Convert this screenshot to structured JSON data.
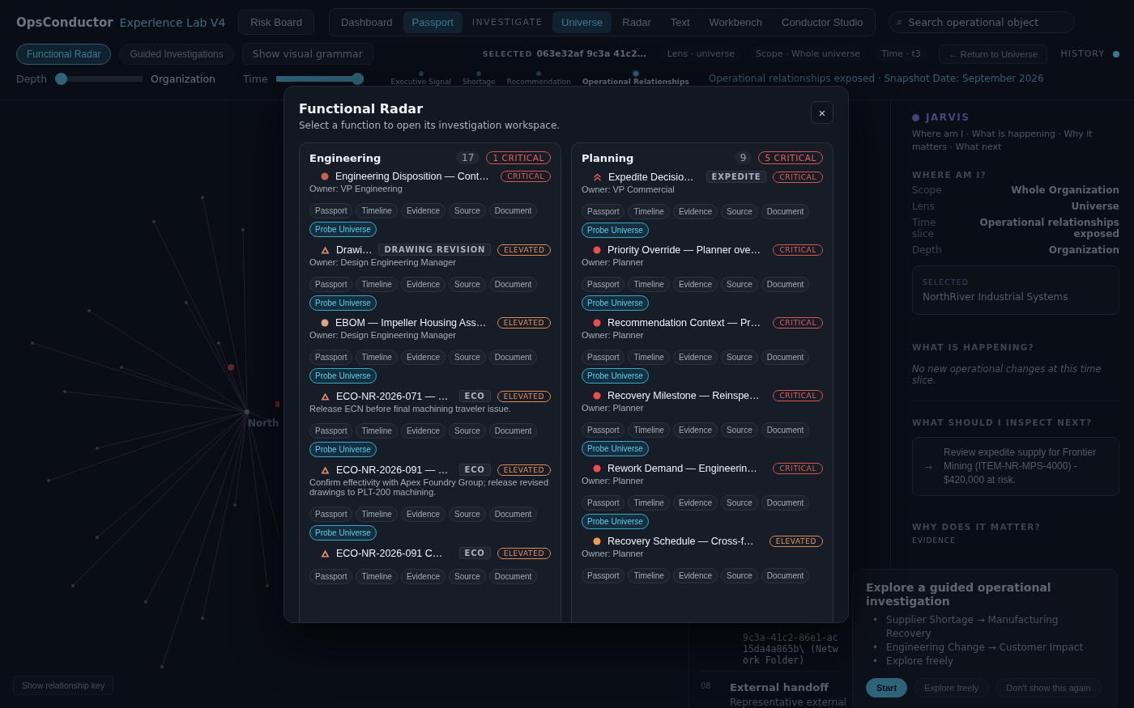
{
  "header": {
    "brand": "OpsConductor",
    "product": "Experience Lab V4",
    "risk_board": "Risk Board",
    "nav_primary": [
      {
        "label": "Dashboard",
        "selected": false
      },
      {
        "label": "Passport",
        "selected": true
      }
    ],
    "section_label": "INVESTIGATE",
    "nav_investigate": [
      {
        "label": "Universe",
        "selected": true
      },
      {
        "label": "Radar",
        "selected": false
      },
      {
        "label": "Text",
        "selected": false
      },
      {
        "label": "Workbench",
        "selected": false
      },
      {
        "label": "Conductor Studio",
        "selected": false
      }
    ],
    "search": {
      "icon": "⌕",
      "placeholder": "Search operational object"
    }
  },
  "toolbar": {
    "modes": [
      {
        "label": "Functional Radar",
        "selected": true
      },
      {
        "label": "Guided Investigations",
        "selected": false
      }
    ],
    "grammar_button": "Show visual grammar",
    "selected_label": "SELECTED",
    "selected_value": "063e32af 9c3a 41c2…",
    "context_chips": [
      "Lens · universe",
      "Scope · Whole universe",
      "Time · t3"
    ],
    "return_button": "← Return to Universe",
    "history": "HISTORY"
  },
  "controls": {
    "depth": {
      "label": "Depth",
      "level": 0,
      "value": "Organization"
    },
    "time": {
      "label": "Time",
      "level": 1
    },
    "steps": [
      {
        "label": "Executive Signal",
        "selected": false
      },
      {
        "label": "Shortage",
        "selected": false
      },
      {
        "label": "Recommendation",
        "selected": false
      },
      {
        "label": "Operational Relationships",
        "selected": true
      }
    ],
    "status": "Operational relationships exposed · Snapshot Date: September 2026"
  },
  "canvas": {
    "node_label": "North",
    "key_button": "Show relationship key"
  },
  "steps_panel": {
    "fragment": "9c3a-41c2-86e1-ac15da4a865b\\ (Network Folder)",
    "number": "08",
    "title": "External handoff",
    "text": "Representative external"
  },
  "jarvis": {
    "title": "JARVIS",
    "subtitle": "Where am I · What is happening · Why it matters · What next",
    "where_heading": "WHERE AM I?",
    "facts": [
      {
        "label": "Scope",
        "value": "Whole Organization"
      },
      {
        "label": "Lens",
        "value": "Universe"
      },
      {
        "label": "Time slice",
        "value": "Operational relationships exposed"
      },
      {
        "label": "Depth",
        "value": "Organization"
      }
    ],
    "selected_label": "SELECTED",
    "selected_value": "NorthRiver Industrial Systems",
    "happening_heading": "WHAT IS HAPPENING?",
    "happening_text": "No new operational changes at this time slice.",
    "next_heading": "WHAT SHOULD I INSPECT NEXT?",
    "next_arrow": "→",
    "next_text": "Review expedite supply for Frontier Mining (ITEM-NR-MPS-4000) - $420,000 at risk.",
    "why_heading": "WHY DOES IT MATTER?",
    "evidence_label": "EVIDENCE"
  },
  "guide": {
    "title": "Explore a guided operational investigation",
    "bullets": [
      {
        "marker": "•",
        "text": "Supplier Shortage → Manufacturing Recovery"
      },
      {
        "marker": "•",
        "text": "Engineering Change → Customer Impact"
      },
      {
        "marker": "•",
        "text": "Explore freely"
      }
    ],
    "buttons": [
      {
        "label": "Start",
        "kind": "primary"
      },
      {
        "label": "Explore freely",
        "kind": "secondary"
      },
      {
        "label": "Don't show this again",
        "kind": "secondary"
      }
    ]
  },
  "modal": {
    "title": "Functional Radar",
    "subtitle": "Select a function to open its investigation workspace.",
    "close": "×",
    "columns": [
      {
        "name": "Engineering",
        "count": "17",
        "critical": "1 CRITICAL",
        "items": [
          {
            "kind": "dot",
            "color": "#c8604e",
            "title": "Engineering Disposition — Cont…",
            "badge": {
              "kind": "critical",
              "label": "CRITICAL"
            },
            "note": "Owner: VP Engineering",
            "actions": [
              "Passport",
              "Timeline",
              "Evidence",
              "Source",
              "Document"
            ],
            "probe": "Probe Universe"
          },
          {
            "kind": "triangle",
            "color": "#d98a6a",
            "title": "Drawi…",
            "tag": "DRAWING REVISION",
            "badge": {
              "kind": "elevated",
              "label": "ELEVATED"
            },
            "note": "Owner: Design Engineering Manager",
            "actions": [
              "Passport",
              "Timeline",
              "Evidence",
              "Source",
              "Document"
            ],
            "probe": "Probe Universe"
          },
          {
            "kind": "dot",
            "color": "#d9a58a",
            "title": "EBOM — Impeller Housing Ass…",
            "badge": {
              "kind": "elevated",
              "label": "ELEVATED"
            },
            "note": "Owner: Design Engineering Manager",
            "actions": [
              "Passport",
              "Timeline",
              "Evidence",
              "Source",
              "Document"
            ],
            "probe": "Probe Universe"
          },
          {
            "kind": "triangle",
            "color": "#d98a6a",
            "title": "ECO-NR-2026-071 — …",
            "tag": "ECO",
            "badge": {
              "kind": "elevated",
              "label": "ELEVATED"
            },
            "note": "Release ECN before final machining traveler issue.",
            "actions": [
              "Passport",
              "Timeline",
              "Evidence",
              "Source",
              "Document"
            ],
            "probe": "Probe Universe"
          },
          {
            "kind": "triangle",
            "color": "#d98a6a",
            "title": "ECO-NR-2026-091 — …",
            "tag": "ECO",
            "badge": {
              "kind": "elevated",
              "label": "ELEVATED"
            },
            "note": "Confirm effectivity with Apex Foundry Group; release revised drawings to PLT-200 machining.",
            "actions": [
              "Passport",
              "Timeline",
              "Evidence",
              "Source",
              "Document"
            ],
            "probe": "Probe Universe"
          },
          {
            "kind": "triangle",
            "color": "#d98a6a",
            "title": "ECO-NR-2026-091 C…",
            "tag": "ECO",
            "badge": {
              "kind": "elevated",
              "label": "ELEVATED"
            },
            "actions": [
              "Passport",
              "Timeline",
              "Evidence",
              "Source",
              "Document"
            ]
          }
        ]
      },
      {
        "name": "Planning",
        "count": "9",
        "critical": "5 CRITICAL",
        "items": [
          {
            "kind": "chevrons",
            "color": "#e8584e",
            "title": "Expedite Decisio…",
            "tag": "EXPEDITE",
            "badge": {
              "kind": "critical",
              "label": "CRITICAL"
            },
            "note": "Owner: VP Commercial",
            "actions": [
              "Passport",
              "Timeline",
              "Evidence",
              "Source",
              "Document"
            ],
            "probe": "Probe Universe"
          },
          {
            "kind": "dot",
            "color": "#ef4d4d",
            "title": "Priority Override — Planner ove…",
            "badge": {
              "kind": "critical",
              "label": "CRITICAL"
            },
            "note": "Owner: Planner",
            "actions": [
              "Passport",
              "Timeline",
              "Evidence",
              "Source",
              "Document"
            ],
            "probe": "Probe Universe"
          },
          {
            "kind": "dot",
            "color": "#ef4d4d",
            "title": "Recommendation Context — Pr…",
            "badge": {
              "kind": "critical",
              "label": "CRITICAL"
            },
            "note": "Owner: Planner",
            "actions": [
              "Passport",
              "Timeline",
              "Evidence",
              "Source",
              "Document"
            ],
            "probe": "Probe Universe"
          },
          {
            "kind": "dot",
            "color": "#ef4d4d",
            "title": "Recovery Milestone — Reinspe…",
            "badge": {
              "kind": "critical",
              "label": "CRITICAL"
            },
            "note": "Owner: Planner",
            "actions": [
              "Passport",
              "Timeline",
              "Evidence",
              "Source",
              "Document"
            ],
            "probe": "Probe Universe"
          },
          {
            "kind": "dot",
            "color": "#ef4d4d",
            "title": "Rework Demand — Engineerin…",
            "badge": {
              "kind": "critical",
              "label": "CRITICAL"
            },
            "note": "Owner: Planner",
            "actions": [
              "Passport",
              "Timeline",
              "Evidence",
              "Source",
              "Document"
            ],
            "probe": "Probe Universe"
          },
          {
            "kind": "dot",
            "color": "#f59a4a",
            "title": "Recovery Schedule — Cross-f…",
            "badge": {
              "kind": "elevated",
              "label": "ELEVATED"
            },
            "note": "Owner: Planner",
            "actions": [
              "Passport",
              "Timeline",
              "Evidence",
              "Source",
              "Document"
            ]
          }
        ]
      }
    ]
  }
}
